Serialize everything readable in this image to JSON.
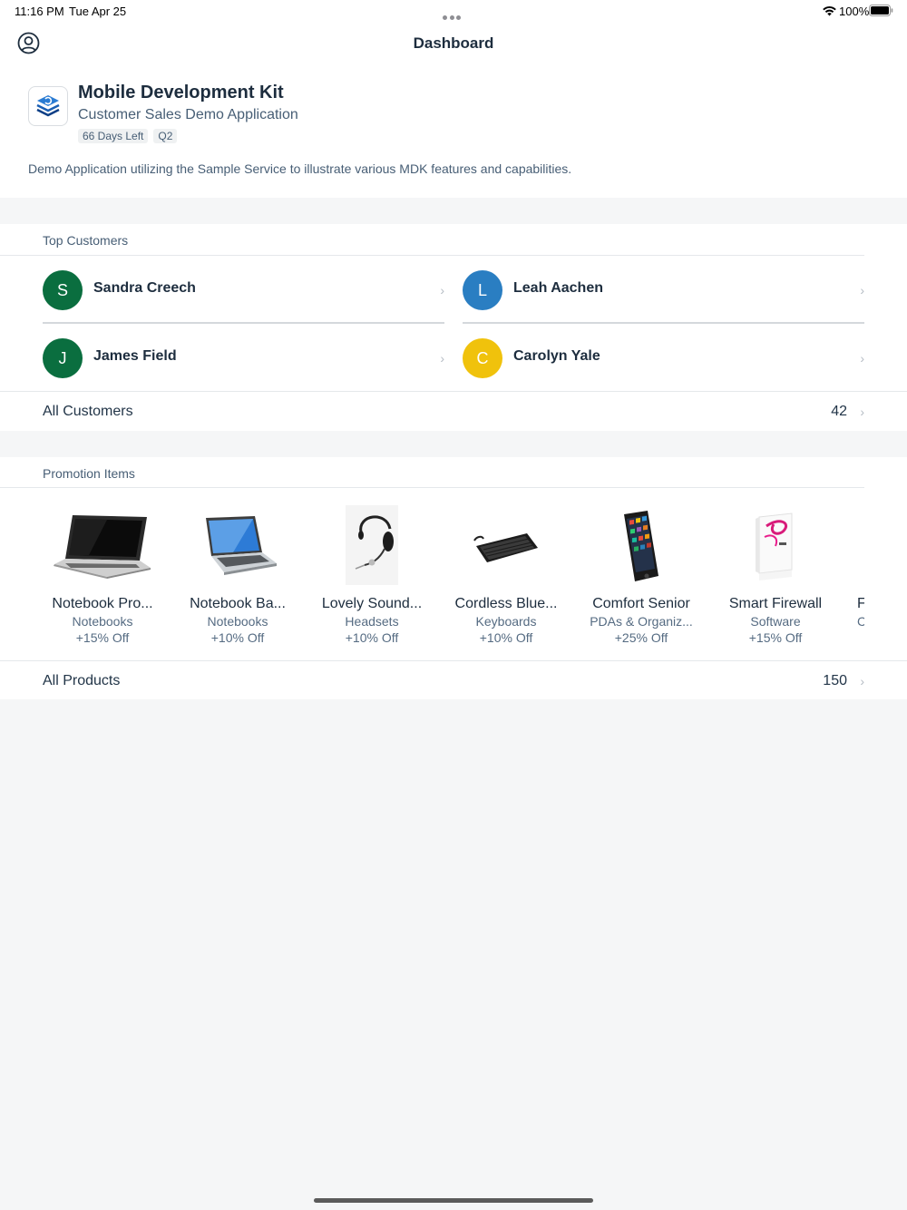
{
  "status_bar": {
    "time": "11:16 PM",
    "date": "Tue Apr 25",
    "battery": "100%"
  },
  "nav": {
    "title": "Dashboard"
  },
  "header": {
    "title": "Mobile Development Kit",
    "subtitle": "Customer Sales Demo Application",
    "tags": [
      "66 Days Left",
      "Q2"
    ],
    "description": "Demo Application utilizing the Sample Service to illustrate various MDK features and capabilities."
  },
  "top_customers": {
    "header": "Top Customers",
    "items": [
      {
        "initial": "S",
        "name": "Sandra Creech",
        "color": "#0a6e3f"
      },
      {
        "initial": "L",
        "name": "Leah Aachen",
        "color": "#2a7ec2"
      },
      {
        "initial": "J",
        "name": "James Field",
        "color": "#0a6e3f"
      },
      {
        "initial": "C",
        "name": "Carolyn Yale",
        "color": "#f0c20c"
      }
    ],
    "footer_label": "All Customers",
    "footer_count": "42"
  },
  "promotions": {
    "header": "Promotion Items",
    "items": [
      {
        "name": "Notebook Pro...",
        "category": "Notebooks",
        "discount": "+15% Off",
        "icon": "laptop-icon"
      },
      {
        "name": "Notebook Ba...",
        "category": "Notebooks",
        "discount": "+10% Off",
        "icon": "laptop-blue-icon"
      },
      {
        "name": "Lovely Sound...",
        "category": "Headsets",
        "discount": "+10% Off",
        "icon": "headset-icon"
      },
      {
        "name": "Cordless Blue...",
        "category": "Keyboards",
        "discount": "+10% Off",
        "icon": "keyboard-icon"
      },
      {
        "name": "Comfort Senior",
        "category": "PDAs & Organiz...",
        "discount": "+25% Off",
        "icon": "phone-icon"
      },
      {
        "name": "Smart Firewall",
        "category": "Software",
        "discount": "+15% Off",
        "icon": "software-box-icon"
      },
      {
        "name": "F",
        "category": "C",
        "discount": "",
        "icon": ""
      }
    ],
    "footer_label": "All Products",
    "footer_count": "150"
  },
  "colors": {
    "accent": "#0a6e3f",
    "text": "#1d2d3e",
    "secondary_text": "#475e75",
    "background": "#f5f6f7"
  }
}
